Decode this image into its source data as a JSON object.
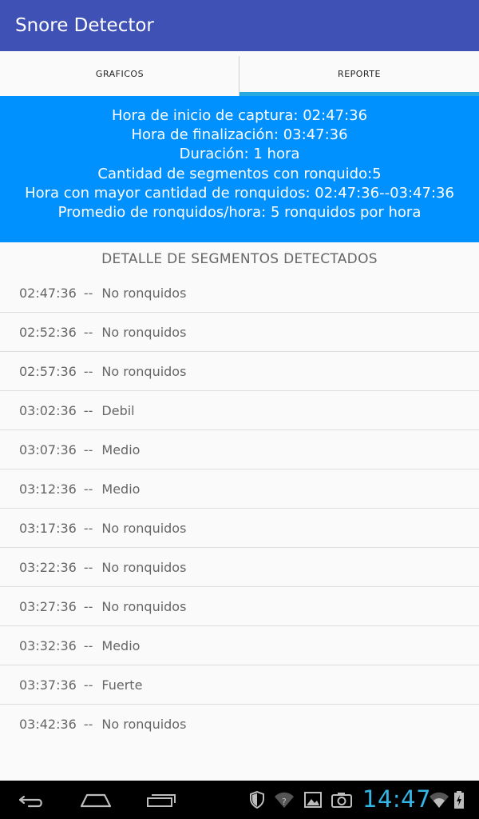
{
  "app": {
    "title": "Snore Detector"
  },
  "tabs": [
    {
      "label": "GRAFICOS",
      "active": false
    },
    {
      "label": "REPORTE",
      "active": true
    }
  ],
  "summary": {
    "lines": [
      "Hora de inicio de captura: 02:47:36",
      "Hora de finalización: 03:47:36",
      "Duración: 1 hora",
      "Cantidad de segmentos con ronquido:5",
      "Hora con mayor cantidad de ronquidos: 02:47:36--03:47:36",
      "Promedio de ronquidos/hora: 5 ronquidos por hora"
    ]
  },
  "segments": {
    "title": "DETALLE DE SEGMENTOS DETECTADOS",
    "separator": "--",
    "items": [
      {
        "time": "02:47:36",
        "level": "No ronquidos"
      },
      {
        "time": "02:52:36",
        "level": "No ronquidos"
      },
      {
        "time": "02:57:36",
        "level": "No ronquidos"
      },
      {
        "time": "03:02:36",
        "level": "Debil"
      },
      {
        "time": "03:07:36",
        "level": "Medio"
      },
      {
        "time": "03:12:36",
        "level": "Medio"
      },
      {
        "time": "03:17:36",
        "level": "No ronquidos"
      },
      {
        "time": "03:22:36",
        "level": "No ronquidos"
      },
      {
        "time": "03:27:36",
        "level": "No ronquidos"
      },
      {
        "time": "03:32:36",
        "level": "Medio"
      },
      {
        "time": "03:37:36",
        "level": "Fuerte"
      },
      {
        "time": "03:42:36",
        "level": "No ronquidos"
      }
    ]
  },
  "statusbar": {
    "clock": "14:47",
    "icons": [
      "shield-icon",
      "wifi-question-icon",
      "gallery-icon",
      "camera-icon",
      "wifi-signal-icon",
      "battery-charging-icon"
    ]
  },
  "navbar": {
    "buttons": [
      "back-icon",
      "home-icon",
      "recent-apps-icon"
    ]
  },
  "colors": {
    "appbar": "#3f51b5",
    "summary_bg": "#0091ff",
    "tab_indicator": "#29a8e0",
    "clock": "#33b5e5"
  }
}
